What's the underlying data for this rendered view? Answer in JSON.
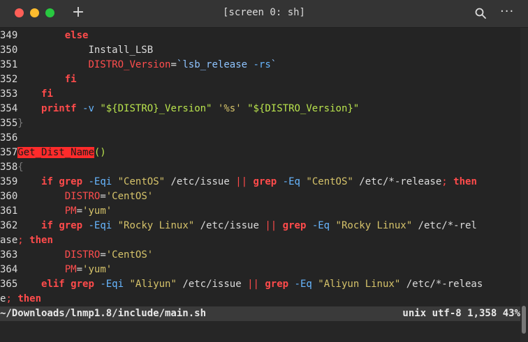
{
  "window": {
    "title": "[screen 0: sh]",
    "colors": {
      "close": "#ff5f57",
      "minimize": "#febc2e",
      "maximize": "#28c840"
    },
    "new_tab_label": "+",
    "more_label": "···"
  },
  "editor": {
    "lines": {
      "l349": {
        "num": "349",
        "t1": "        ",
        "t2": "else"
      },
      "l350": {
        "num": "350",
        "t1": "            Install_LSB"
      },
      "l351": {
        "num": "351",
        "t1": "            ",
        "t2": "DISTRO_Version",
        "t3": "=",
        "t4": "`",
        "t5": "lsb_release",
        "t6": " ",
        "t7": "-rs",
        "t8": "`"
      },
      "l352": {
        "num": "352",
        "t1": "        ",
        "t2": "fi"
      },
      "l353": {
        "num": "353",
        "t1": "    ",
        "t2": "fi"
      },
      "l354": {
        "num": "354",
        "t1": "    ",
        "t2": "printf",
        "t3": " ",
        "t4": "-v",
        "t5": " ",
        "t6": "\"${DISTRO}_Version\"",
        "t7": " ",
        "t8": "'%s'",
        "t9": " ",
        "t10": "\"${DISTRO_Version}\""
      },
      "l355": {
        "num": "355",
        "t1": "}"
      },
      "l356": {
        "num": "356"
      },
      "l357": {
        "num": "357",
        "t1": "Get_Dist_Name",
        "t2": "()"
      },
      "l358": {
        "num": "358",
        "t1": "{"
      },
      "l359": {
        "num": "359",
        "t1": "    ",
        "t2": "if",
        "t3": " ",
        "t4": "grep",
        "t5": " ",
        "t6": "-Eqi",
        "t7": " ",
        "t8": "\"CentOS\"",
        "t9": " /etc/issue ",
        "t10": "||",
        "t11": " ",
        "t12": "grep",
        "t13": " ",
        "t14": "-Eq",
        "t15": " ",
        "t16": "\"CentOS\"",
        "t17": " /etc/*-release",
        "t18": ";",
        "t19": " ",
        "t20": "then"
      },
      "l360": {
        "num": "360",
        "t1": "        ",
        "t2": "DISTRO",
        "t3": "=",
        "t4": "'CentOS'"
      },
      "l361": {
        "num": "361",
        "t1": "        ",
        "t2": "PM",
        "t3": "=",
        "t4": "'yum'"
      },
      "l362": {
        "num": "362",
        "t1": "    ",
        "t2": "if",
        "t3": " ",
        "t4": "grep",
        "t5": " ",
        "t6": "-Eqi",
        "t7": " ",
        "t8": "\"Rocky Linux\"",
        "t9": " /etc/issue ",
        "t10": "||",
        "t11": " ",
        "t12": "grep",
        "t13": " ",
        "t14": "-Eq",
        "t15": " ",
        "t16": "\"Rocky Linux\"",
        "t17": " /etc/*-rel"
      },
      "l362b": {
        "t1": "ase",
        "t2": ";",
        "t3": " ",
        "t4": "then"
      },
      "l363": {
        "num": "363",
        "t1": "        ",
        "t2": "DISTRO",
        "t3": "=",
        "t4": "'CentOS'"
      },
      "l364": {
        "num": "364",
        "t1": "        ",
        "t2": "PM",
        "t3": "=",
        "t4": "'yum'"
      },
      "l365": {
        "num": "365",
        "t1": "    ",
        "t2": "elif",
        "t3": " ",
        "t4": "grep",
        "t5": " ",
        "t6": "-Eqi",
        "t7": " ",
        "t8": "\"Aliyun\"",
        "t9": " /etc/issue ",
        "t10": "||",
        "t11": " ",
        "t12": "grep",
        "t13": " ",
        "t14": "-Eq",
        "t15": " ",
        "t16": "\"Aliyun Linux\"",
        "t17": " /etc/*-releas"
      },
      "l365b": {
        "t1": "e",
        "t2": ";",
        "t3": " ",
        "t4": "then"
      }
    }
  },
  "status": {
    "file": "~/Downloads/lnmp1.8/include/main.sh",
    "info": "unix utf-8 1,358 43%"
  }
}
